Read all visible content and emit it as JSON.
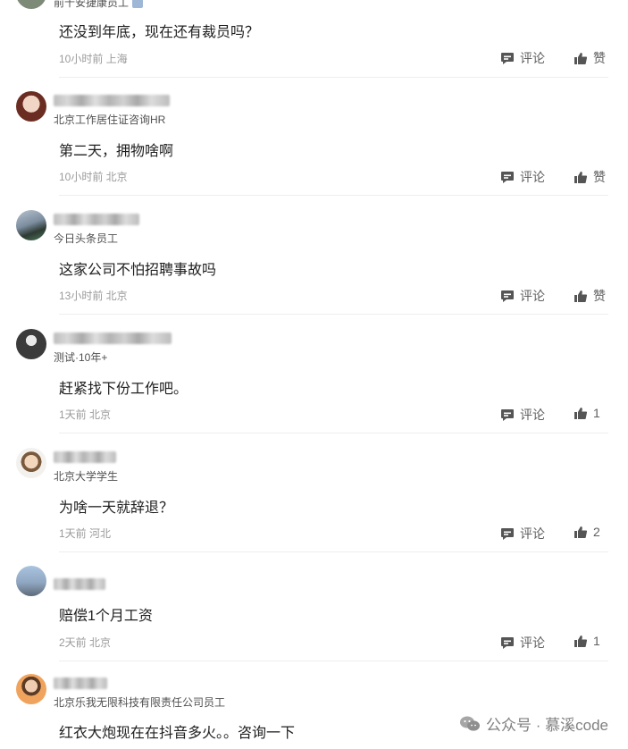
{
  "actions": {
    "comment_label": "评论",
    "like_label": "赞"
  },
  "comments": [
    {
      "subtitle": "前十安捷康员工",
      "text": "还没到年底，现在还有裁员吗？",
      "meta": "10小时前 上海",
      "likes": "赞"
    },
    {
      "subtitle": "北京工作居住证咨询HR",
      "text": "第二天，拥物啥啊",
      "meta": "10小时前 北京",
      "likes": "赞"
    },
    {
      "subtitle": "今日头条员工",
      "text": "这家公司不怕招聘事故吗",
      "meta": "13小时前 北京",
      "likes": "赞"
    },
    {
      "subtitle": "测试·10年+",
      "text": "赶紧找下份工作吧。",
      "meta": "1天前 北京",
      "likes": "1"
    },
    {
      "subtitle": "北京大学学生",
      "text": "为啥一天就辞退？",
      "meta": "1天前 河北",
      "likes": "2"
    },
    {
      "subtitle": "",
      "text": "赔偿1个月工资",
      "meta": "2天前 北京",
      "likes": "1"
    },
    {
      "subtitle": "北京乐我无限科技有限责任公司员工",
      "text": "红衣大炮现在在抖音多火。。咨询一下",
      "meta": "",
      "likes": ""
    }
  ],
  "watermark": {
    "text": "公众号 · 慕溪code"
  }
}
